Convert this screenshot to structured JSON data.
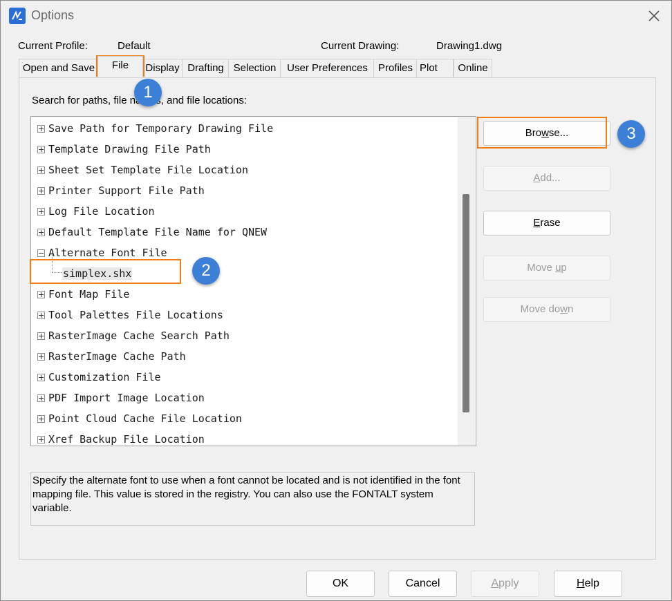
{
  "window": {
    "title": "Options",
    "close_label": "×"
  },
  "header": {
    "profile_label": "Current Profile:",
    "profile_value": "Default",
    "drawing_label": "Current Drawing:",
    "drawing_value": "Drawing1.dwg"
  },
  "tabs": [
    {
      "label": "Open and Save"
    },
    {
      "label": "File"
    },
    {
      "label": "Display"
    },
    {
      "label": "Drafting"
    },
    {
      "label": "Selection"
    },
    {
      "label": "User Preferences"
    },
    {
      "label": "Profiles"
    },
    {
      "label": "Plot"
    },
    {
      "label": "Online"
    }
  ],
  "main": {
    "search_label": "Search for paths, file names, and file locations:",
    "tree": [
      {
        "label": "Save Path for Temporary Drawing File"
      },
      {
        "label": "Template Drawing File Path"
      },
      {
        "label": "Sheet Set Template File Location"
      },
      {
        "label": "Printer Support File Path"
      },
      {
        "label": "Log File Location"
      },
      {
        "label": "Default Template File Name for QNEW"
      },
      {
        "label": "Alternate Font File"
      },
      {
        "label": "simplex.shx"
      },
      {
        "label": "Font Map File"
      },
      {
        "label": "Tool Palettes File Locations"
      },
      {
        "label": "RasterImage Cache Search Path"
      },
      {
        "label": "RasterImage Cache Path"
      },
      {
        "label": "Customization File"
      },
      {
        "label": "PDF Import Image Location"
      },
      {
        "label": "Point Cloud Cache File Location"
      },
      {
        "label": "Xref Backup File Location"
      }
    ],
    "description": "Specify the alternate font to use when a font cannot be located and is not identified in the font mapping file. This value is stored in the registry. You can also use the FONTALT system variable."
  },
  "side_buttons": {
    "browse_pre": "Bro",
    "browse_key": "w",
    "browse_post": "se...",
    "add_pre": "",
    "add_key": "A",
    "add_post": "dd...",
    "erase_pre": "",
    "erase_key": "E",
    "erase_post": "rase",
    "moveup_pre": "Move ",
    "moveup_key": "u",
    "moveup_post": "p",
    "movedown_pre": "Move do",
    "movedown_key": "w",
    "movedown_post": "n"
  },
  "footer": {
    "ok": "OK",
    "cancel": "Cancel",
    "apply_key": "A",
    "apply_post": "pply",
    "help_key": "H",
    "help_post": "elp"
  },
  "annotations": {
    "one": "1",
    "two": "2",
    "three": "3",
    "color": "#f07d12",
    "badge_color": "#3c7fd6"
  }
}
